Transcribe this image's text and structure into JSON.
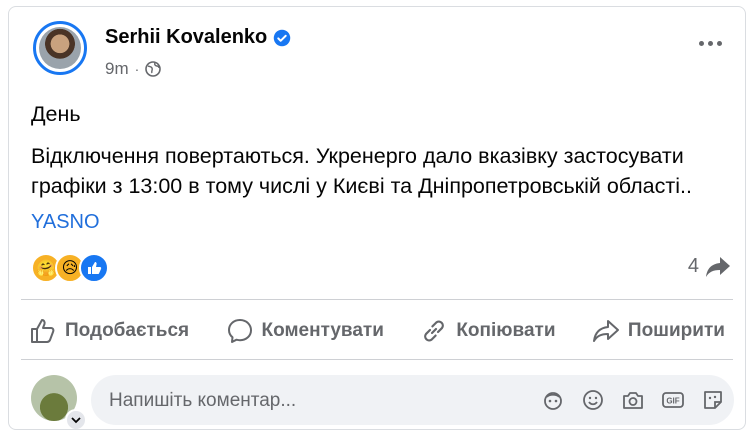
{
  "post": {
    "author": "Serhii Kovalenko",
    "time": "9m",
    "separator": "·",
    "lines": [
      "День",
      "Відключення повертаються. Укренерго дало вказівку застосувати графіки з 13:00 в тому числі у Києві та Дніпропетровській області.."
    ],
    "link_text": "YASNO",
    "share_count": "4"
  },
  "reactions": [
    {
      "name": "care-reaction",
      "emoji": "🤗"
    },
    {
      "name": "sad-reaction",
      "emoji": "😥"
    },
    {
      "name": "like-reaction",
      "emoji": "👍"
    }
  ],
  "actions": {
    "like": "Подобається",
    "comment": "Коментувати",
    "copy": "Копіювати",
    "share": "Поширити"
  },
  "composer": {
    "placeholder": "Напишіть коментар..."
  },
  "colors": {
    "accent": "#1877f2",
    "link": "#216fdb",
    "muted": "#65676b"
  }
}
